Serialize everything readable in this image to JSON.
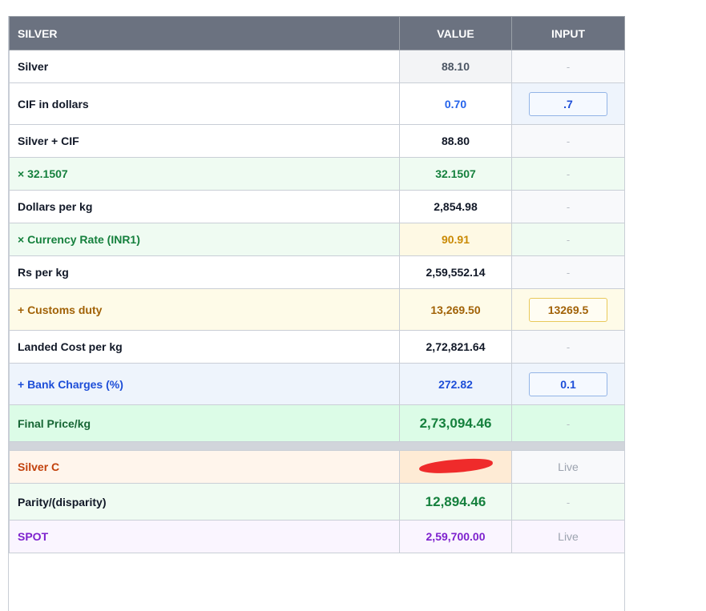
{
  "header": {
    "col1": "SILVER",
    "col2": "VALUE",
    "col3": "INPUT"
  },
  "colors": {
    "header_bg": "#6b7280",
    "green_text": "#15803d",
    "blue_text": "#1d4ed8",
    "amber_text": "#a16207",
    "orange_text": "#c2410c",
    "purple_text": "#7e22ce"
  },
  "rows": [
    {
      "label": "Silver",
      "value": "88.10",
      "input": "-"
    },
    {
      "label": "CIF in dollars",
      "value": "0.70",
      "input": ".7"
    },
    {
      "label": "Silver + CIF",
      "value": "88.80",
      "input": "-"
    },
    {
      "label": "× 32.1507",
      "value": "32.1507",
      "input": "-"
    },
    {
      "label": "Dollars per kg",
      "value": "2,854.98",
      "input": "-"
    },
    {
      "label": "× Currency Rate (INR1)",
      "value": "90.91",
      "input": "-"
    },
    {
      "label": "Rs per kg",
      "value": "2,59,552.14",
      "input": "-"
    },
    {
      "label": "+ Customs duty",
      "value": "13,269.50",
      "input": "13269.5"
    },
    {
      "label": "Landed Cost per kg",
      "value": "2,72,821.64",
      "input": "-"
    },
    {
      "label": "+ Bank Charges (%)",
      "value": "272.82",
      "input": "0.1"
    },
    {
      "label": "Final Price/kg",
      "value": "2,73,094.46",
      "input": "-"
    }
  ],
  "lower_rows": [
    {
      "label": "Silver C",
      "value": "[redacted]",
      "input": "Live"
    },
    {
      "label": "Parity/(disparity)",
      "value": "12,894.46",
      "input": "-"
    },
    {
      "label": "SPOT",
      "value": "2,59,700.00",
      "input": "Live"
    }
  ]
}
